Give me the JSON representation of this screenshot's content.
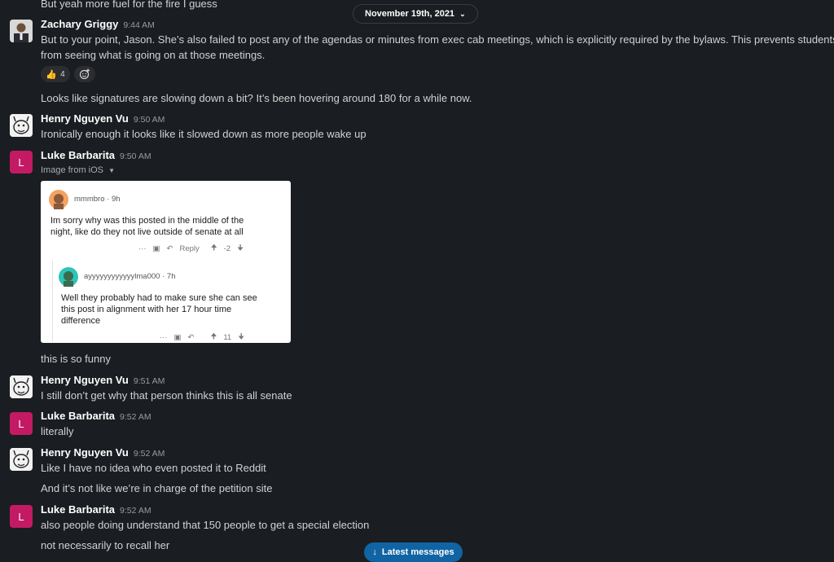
{
  "top_fragment": "But yeah more fuel for the fire I guess",
  "date_divider": {
    "label": "November 19th, 2021"
  },
  "messages": [
    {
      "author": "Zachary Griggy",
      "time": "9:44 AM",
      "line1": "But to your point, Jason. She’s also failed to post any of the agendas or minutes from exec cab meetings, which is explicitly required by the bylaws. This prevents students",
      "line2": "from seeing what is going on at those meetings.",
      "reaction_count": "4",
      "followup": "Looks like signatures are slowing down a bit? It’s been hovering around 180 for a while now."
    },
    {
      "author": "Henry Nguyen Vu",
      "time": "9:50 AM",
      "text": "Ironically enough it looks like it slowed down as more people wake up"
    },
    {
      "author": "Luke Barbarita",
      "avatar_letter": "L",
      "time": "9:50 AM",
      "attachment_label": "Image from iOS",
      "followup": "this is so funny"
    },
    {
      "author": "Henry Nguyen Vu",
      "time": "9:51 AM",
      "text": "I still don’t get why that person thinks this is all senate"
    },
    {
      "author": "Luke Barbarita",
      "avatar_letter": "L",
      "time": "9:52 AM",
      "text": "literally"
    },
    {
      "author": "Henry Nguyen Vu",
      "time": "9:52 AM",
      "text": "Like I have no idea who even posted it to Reddit",
      "followup": "And it’s not like we’re in charge of the petition site"
    },
    {
      "author": "Luke Barbarita",
      "avatar_letter": "L",
      "time": "9:52 AM",
      "text": "also people doing understand that 150 people to get a special election",
      "followup": "not necessarily to recall her"
    }
  ],
  "reddit_screenshot": {
    "comment1": {
      "user": "mmmbro",
      "age": "9h",
      "line1": "Im sorry why was this posted in the middle of the",
      "line2": "night, like do they not live outside of senate at all",
      "more": "···",
      "reply_label": "Reply",
      "score": "-2"
    },
    "comment2": {
      "user": "ayyyyyyyyyyyylma000",
      "age": "7h",
      "line1": "Well they probably had to make sure she can see",
      "line2": "this post in alignment with her 17 hour time",
      "line3": "difference",
      "more": "···",
      "score": "11"
    }
  },
  "latest_button": {
    "label": "Latest messages"
  },
  "colors": {
    "background": "#1a1d21",
    "luke_avatar": "#c41a63",
    "latest_button": "#1164a3"
  },
  "icons": [
    "thumbs-up-icon",
    "add-reaction-icon",
    "chevron-down-icon",
    "arrow-down-icon",
    "upvote-icon",
    "downvote-icon",
    "reply-icon",
    "award-icon"
  ]
}
